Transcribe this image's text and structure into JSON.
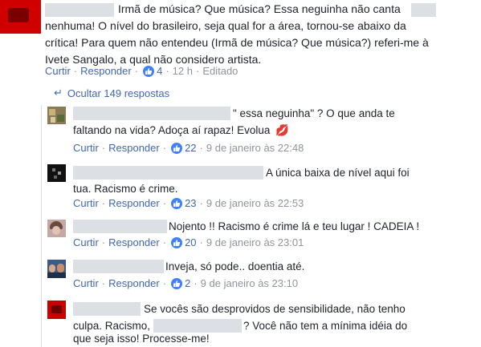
{
  "top_comment": {
    "line1_a": "Irmã de música? Que música? Essa neguinha não canta",
    "line2": "nenhuma! O nível do brasileiro, seja qual for a área, tornou-se abaixo da",
    "line3": "crítica! Para quem não entendeu (Irmã de música? Que música?) referi-me à",
    "line4": "Ivete Sangalo, a qual não considero artista.",
    "actions": {
      "like": "Curtir",
      "reply": "Responder",
      "likes": "4",
      "time": "12 h",
      "edited": "Editado"
    }
  },
  "replies_toggle": {
    "arrow": "↵",
    "label": "Ocultar 149 respostas"
  },
  "replies": [
    {
      "line1": "\" essa neguinha\" ? O que anda te",
      "line2": "faltando na vida? Adoça aí rapaz! Evolua",
      "emoji": "💋",
      "actions": {
        "like": "Curtir",
        "reply": "Responder",
        "likes": "22",
        "time": "9 de janeiro às 22:48"
      }
    },
    {
      "line1": "A única baixa de nível aqui foi",
      "line2": "tua. Racismo é crime.",
      "actions": {
        "like": "Curtir",
        "reply": "Responder",
        "likes": "23",
        "time": "9 de janeiro às 22:53"
      }
    },
    {
      "line1": "Nojento !! Racismo é crime lá e teu lugar ! CADEIA !",
      "actions": {
        "like": "Curtir",
        "reply": "Responder",
        "likes": "20",
        "time": "9 de janeiro às 23:01"
      }
    },
    {
      "line1": "Inveja, só pode.. doentia até.",
      "actions": {
        "like": "Curtir",
        "reply": "Responder",
        "likes": "2",
        "time": "9 de janeiro às 23:10"
      }
    },
    {
      "line1": "Se vocês são desprovidos de sensibilidade, não tenho",
      "line2_a": "culpa. Racismo,",
      "line2_b": "? Você não tem a mínima idéia do",
      "line3": "que seja isso! Processe-me!"
    }
  ],
  "separator": "·",
  "colors": {
    "link": "#4267b2",
    "meta_gray": "#90949c",
    "text": "#1d2129",
    "like_blue": "#4080ff",
    "redaction": "#dcdfe4",
    "thread_line": "#dddfe2"
  },
  "icons": {
    "like": "thumbs-up-icon",
    "toggle": "reply-arrow-icon"
  }
}
